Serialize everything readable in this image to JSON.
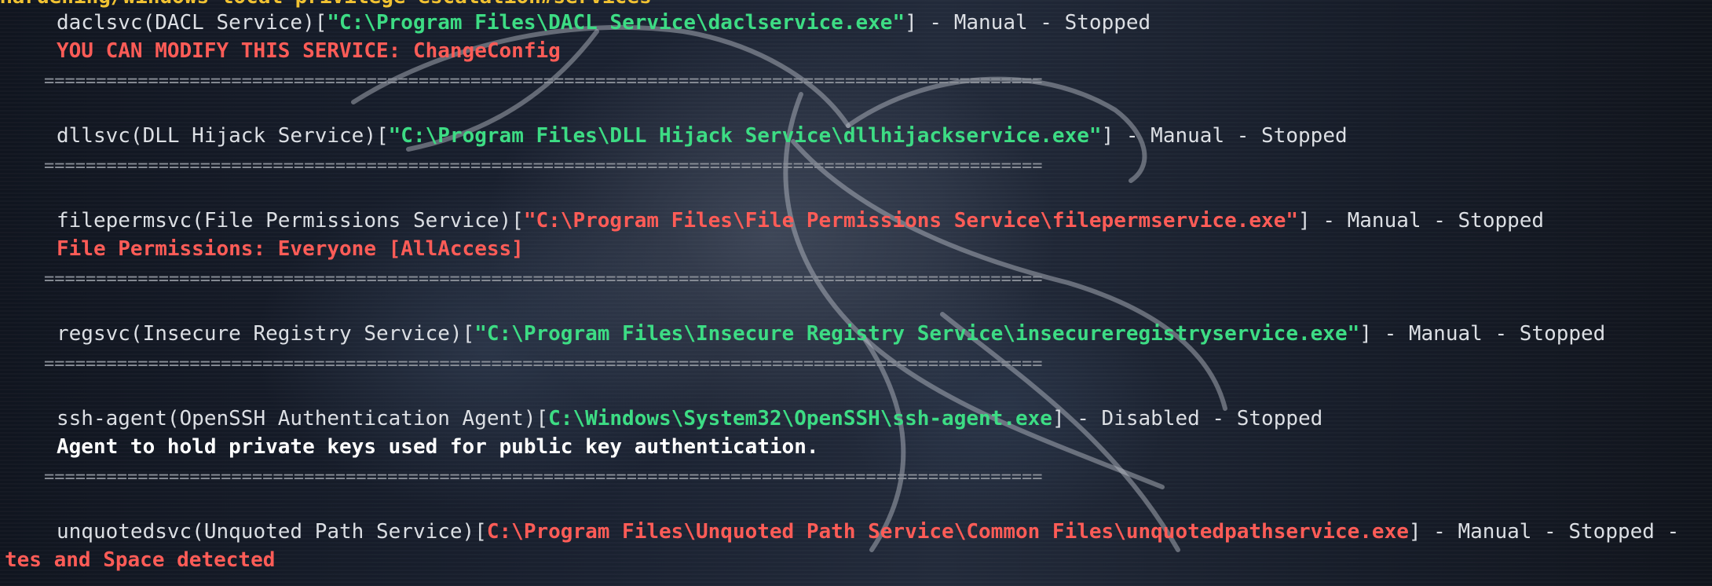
{
  "header_partial": "Hardening/windows-local-privilege-escalation#services",
  "services": [
    {
      "name": "daclsvc(DACL Service)",
      "path": "\"C:\\Program Files\\DACL Service\\daclservice.exe\"",
      "path_color": "#3ddc84",
      "status": "] - Manual - Stopped",
      "note": "YOU CAN MODIFY THIS SERVICE: ChangeConfig",
      "note_color": "#ff5c57"
    },
    {
      "name": "dllsvc(DLL Hijack Service)",
      "path": "\"C:\\Program Files\\DLL Hijack Service\\dllhijackservice.exe\"",
      "path_color": "#3ddc84",
      "status": "] - Manual - Stopped"
    },
    {
      "name": "filepermsvc(File Permissions Service)",
      "path": "\"C:\\Program Files\\File Permissions Service\\filepermservice.exe\"",
      "path_color": "#ff5c57",
      "status": "] - Manual - Stopped",
      "note": "File Permissions: Everyone [AllAccess]",
      "note_color": "#ff5c57"
    },
    {
      "name": "regsvc(Insecure Registry Service)",
      "path": "\"C:\\Program Files\\Insecure Registry Service\\insecureregistryservice.exe\"",
      "path_color": "#3ddc84",
      "status": "] - Manual - Stopped"
    },
    {
      "name": "ssh-agent(OpenSSH Authentication Agent)",
      "path": "C:\\Windows\\System32\\OpenSSH\\ssh-agent.exe",
      "path_color": "#3ddc84",
      "status": "] - Disabled - Stopped",
      "note": "Agent to hold private keys used for public key authentication.",
      "note_color": "#ffffff"
    },
    {
      "name": "unquotedsvc(Unquoted Path Service)",
      "path": "C:\\Program Files\\Unquoted Path Service\\Common Files\\unquotedpathservice.exe",
      "path_color": "#ff5c57",
      "status": "] - Manual - Stopped -",
      "note": "tes and Space detected",
      "note_color": "#ff5c57"
    }
  ],
  "separator": "================================================================================================"
}
